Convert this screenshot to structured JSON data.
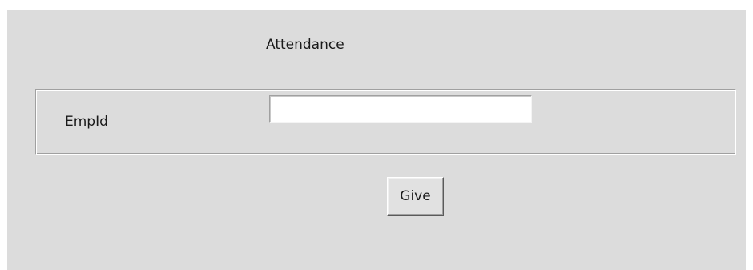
{
  "window": {
    "title": "Attendance"
  },
  "form": {
    "empid_label": "EmpId",
    "empid_value": "",
    "submit_label": "Give"
  },
  "colors": {
    "window_background": "#dcdcdc",
    "input_background": "#ffffff",
    "button_background": "#e1e1e1"
  }
}
